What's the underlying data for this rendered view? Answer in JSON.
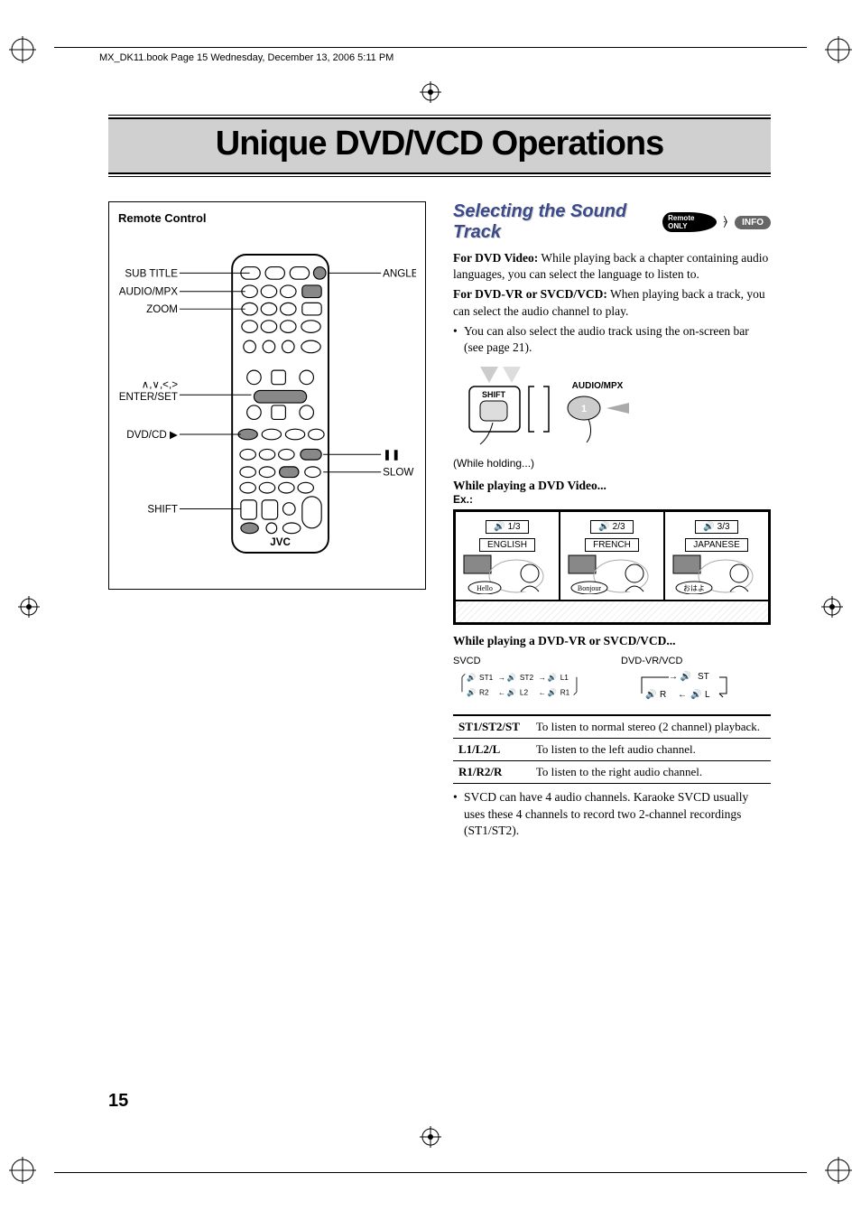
{
  "meta": {
    "header": "MX_DK11.book  Page 15  Wednesday, December 13, 2006  5:11 PM"
  },
  "title": "Unique DVD/VCD Operations",
  "page_number": "15",
  "remote": {
    "box_title": "Remote Control",
    "labels": {
      "subtitle": "SUB TITLE",
      "audio_mpx": "AUDIO/MPX",
      "zoom": "ZOOM",
      "arrows": "∧,∨,<,>",
      "enter_set": "ENTER/SET",
      "dvd_cd": "DVD/CD ▶",
      "shift": "SHIFT",
      "angle": "ANGLE",
      "pause": "❚❚",
      "slow": "SLOW −,+",
      "brand": "JVC"
    }
  },
  "section": {
    "title": "Selecting the Sound Track",
    "badge_remote": "Remote ONLY",
    "badge_info": "INFO",
    "para1a": "For DVD Video:",
    "para1b": " While playing back a chapter containing audio languages, you can select the language to listen to.",
    "para2a": "For DVD-VR or SVCD/VCD:",
    "para2b": " When playing back a track, you can select the audio channel to play.",
    "bullet1": "You can also select the audio track using the on-screen bar (see page 21).",
    "shift_label": "SHIFT",
    "audio_mpx_label": "AUDIO/MPX",
    "button_num": "1",
    "holding": "(While holding...)",
    "dvd_playing": "While playing a DVD Video...",
    "ex": "Ex.:",
    "lang": {
      "c1_count": "1/3",
      "c1_lang": "ENGLISH",
      "c1_say": "Hello",
      "c2_count": "2/3",
      "c2_lang": "FRENCH",
      "c2_say": "Bonjour",
      "c3_count": "3/3",
      "c3_lang": "JAPANESE",
      "c3_say": "おはよ"
    },
    "vr_playing": "While playing a DVD-VR or SVCD/VCD...",
    "cycle": {
      "svcd_title": "SVCD",
      "svcd_items": "ST1 → ST2 → L1 → R1 → L2 → R2 (loop)",
      "svcd_r1": "ST1",
      "svcd_r2": "ST2",
      "svcd_r3": "L1",
      "svcd_r4": "R2",
      "svcd_r5": "L2",
      "svcd_r6": "R1",
      "vr_title": "DVD-VR/VCD",
      "vr_r1": "ST",
      "vr_r2": "L",
      "vr_r3": "R"
    },
    "table": {
      "r1k": "ST1/ST2/ST",
      "r1v": "To listen to normal stereo (2 channel) playback.",
      "r2k": "L1/L2/L",
      "r2v": "To listen to the left audio channel.",
      "r3k": "R1/R2/R",
      "r3v": "To listen to the right audio channel."
    },
    "note": "SVCD can have 4 audio channels. Karaoke SVCD usually uses these 4 channels to record two 2-channel recordings (ST1/ST2)."
  }
}
